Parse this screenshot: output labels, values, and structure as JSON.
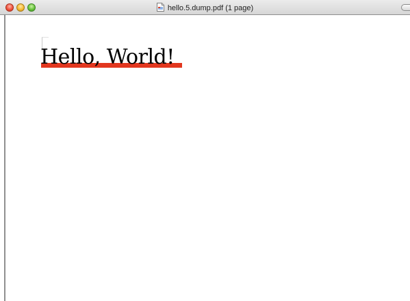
{
  "window": {
    "title": "hello.5.dump.pdf (1 page)",
    "title_icon": "pdf-document-icon",
    "controls": {
      "close_icon": "close-icon",
      "minimize_icon": "minimize-icon",
      "zoom_icon": "zoom-icon"
    },
    "toolbar_toggle_icon": "toolbar-toggle-icon"
  },
  "document": {
    "text": "Hello, World!",
    "highlight_color": "#e2371f",
    "text_color": "#000000"
  },
  "colors": {
    "close": "#f0543f",
    "minimize": "#f6bc36",
    "zoom": "#68c43d",
    "titlebar": "#d6d6d6"
  }
}
